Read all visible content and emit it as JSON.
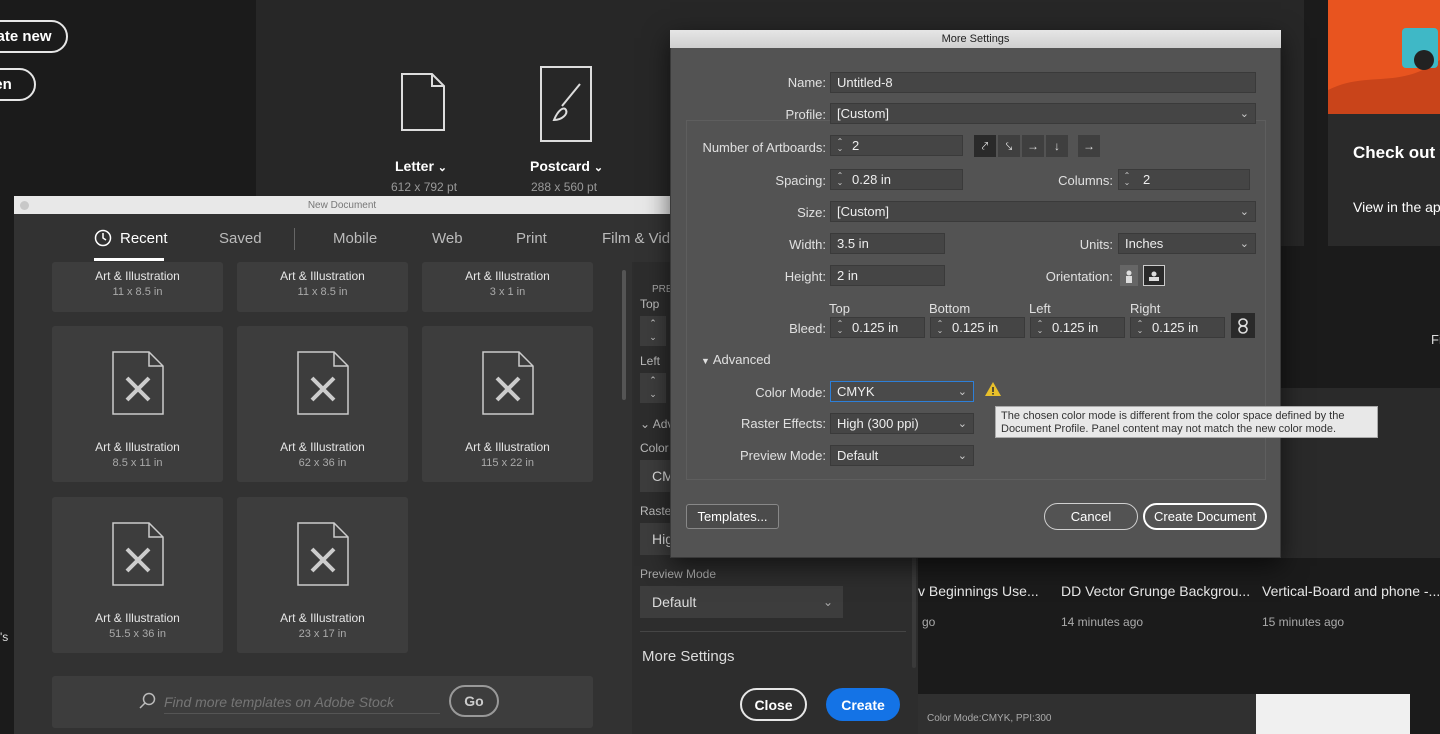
{
  "home": {
    "create_new_label": "ate new",
    "open_label": "en",
    "presets": [
      {
        "name": "Letter",
        "size": "612 x 792 pt"
      },
      {
        "name": "Postcard",
        "size": "288 x 560 pt"
      }
    ],
    "promo_title": "Check out w",
    "promo_sub": "View in the ap",
    "fi_text": "Fi",
    "side_text": "'s",
    "recent_files": [
      {
        "name": "v Beginnings Use...",
        "time": "go"
      },
      {
        "name": "DD Vector Grunge Backgrou...",
        "time": "14 minutes ago"
      },
      {
        "name": "Vertical-Board and phone -...",
        "time": "15 minutes ago"
      }
    ],
    "status_text": "Color Mode:CMYK, PPI:300"
  },
  "new_document": {
    "window_title": "New Document",
    "tabs": [
      "Recent",
      "Saved",
      "Mobile",
      "Web",
      "Print",
      "Film & Vide"
    ],
    "cards": [
      {
        "name": "Art & Illustration",
        "size": "11 x 8.5 in"
      },
      {
        "name": "Art & Illustration",
        "size": "11 x 8.5 in"
      },
      {
        "name": "Art & Illustration",
        "size": "3 x 1 in"
      },
      {
        "name": "Art & Illustration",
        "size": "8.5 x 11 in"
      },
      {
        "name": "Art & Illustration",
        "size": "62 x 36 in"
      },
      {
        "name": "Art & Illustration",
        "size": "115 x 22 in"
      },
      {
        "name": "Art & Illustration",
        "size": "51.5 x 36 in"
      },
      {
        "name": "Art & Illustration",
        "size": "23 x 17 in"
      }
    ],
    "search_placeholder": "Find more templates on Adobe Stock",
    "go_label": "Go",
    "panel": {
      "pre": "PRE",
      "top": "Top",
      "left": "Left",
      "adv": "Adv",
      "color": "Color",
      "color_val": "CM",
      "raster": "Raster",
      "raster_val": "Hig",
      "preview_mode_label": "Preview Mode",
      "preview_mode_value": "Default",
      "more_settings": "More Settings",
      "close": "Close",
      "create": "Create"
    }
  },
  "more_settings": {
    "title": "More Settings",
    "name_label": "Name:",
    "name_value": "Untitled-8",
    "profile_label": "Profile:",
    "profile_value": "[Custom]",
    "artboards_label": "Number of Artboards:",
    "artboards_value": "2",
    "spacing_label": "Spacing:",
    "spacing_value": "0.28 in",
    "columns_label": "Columns:",
    "columns_value": "2",
    "size_label": "Size:",
    "size_value": "[Custom]",
    "width_label": "Width:",
    "width_value": "3.5 in",
    "units_label": "Units:",
    "units_value": "Inches",
    "height_label": "Height:",
    "height_value": "2 in",
    "orientation_label": "Orientation:",
    "bleed_label": "Bleed:",
    "bleed": [
      {
        "label": "Top",
        "value": "0.125 in"
      },
      {
        "label": "Bottom",
        "value": "0.125 in"
      },
      {
        "label": "Left",
        "value": "0.125 in"
      },
      {
        "label": "Right",
        "value": "0.125 in"
      }
    ],
    "advanced_label": "Advanced",
    "color_mode_label": "Color Mode:",
    "color_mode_value": "CMYK",
    "raster_label": "Raster Effects:",
    "raster_value": "High (300 ppi)",
    "preview_label": "Preview Mode:",
    "preview_value": "Default",
    "tooltip": "The chosen color mode is different from the color space defined by the Document Profile. Panel content may not match the new color mode.",
    "templates_label": "Templates...",
    "cancel_label": "Cancel",
    "create_label": "Create Document"
  },
  "colors": {
    "accent": "#1473e6",
    "warning": "#e8c02a",
    "orange": "#e8541f"
  }
}
